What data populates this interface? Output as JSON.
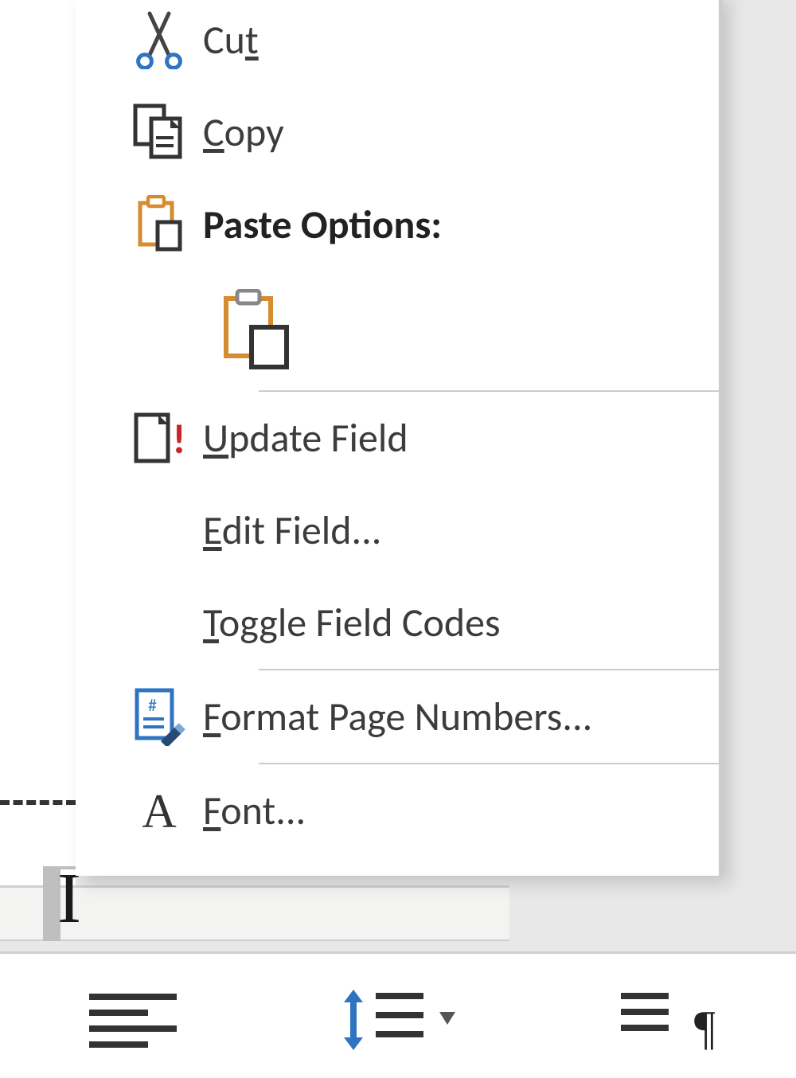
{
  "context_menu": {
    "cut": {
      "pre": "Cu",
      "u": "t",
      "post": ""
    },
    "copy": {
      "pre": "",
      "u": "C",
      "post": "opy"
    },
    "paste_header": {
      "pre": "",
      "u": "",
      "post": "Paste Options:"
    },
    "update_field": {
      "pre": "",
      "u": "U",
      "post": "pdate Field"
    },
    "edit_field": {
      "pre": "",
      "u": "E",
      "post": "dit Field..."
    },
    "toggle_codes": {
      "pre": "",
      "u": "T",
      "post": "oggle Field Codes"
    },
    "format_pagenums": {
      "pre": "",
      "u": "F",
      "post": "ormat Page Numbers..."
    },
    "font": {
      "pre": "",
      "u": "F",
      "post": "ont..."
    },
    "paste_option_name": "keep-source-formatting"
  },
  "toolbar": {
    "btn1": "align-left",
    "btn2": "line-spacing",
    "btn3": "paragraph-marks"
  },
  "colors": {
    "accent_orange": "#d78b2f",
    "accent_blue": "#2f74c2"
  }
}
